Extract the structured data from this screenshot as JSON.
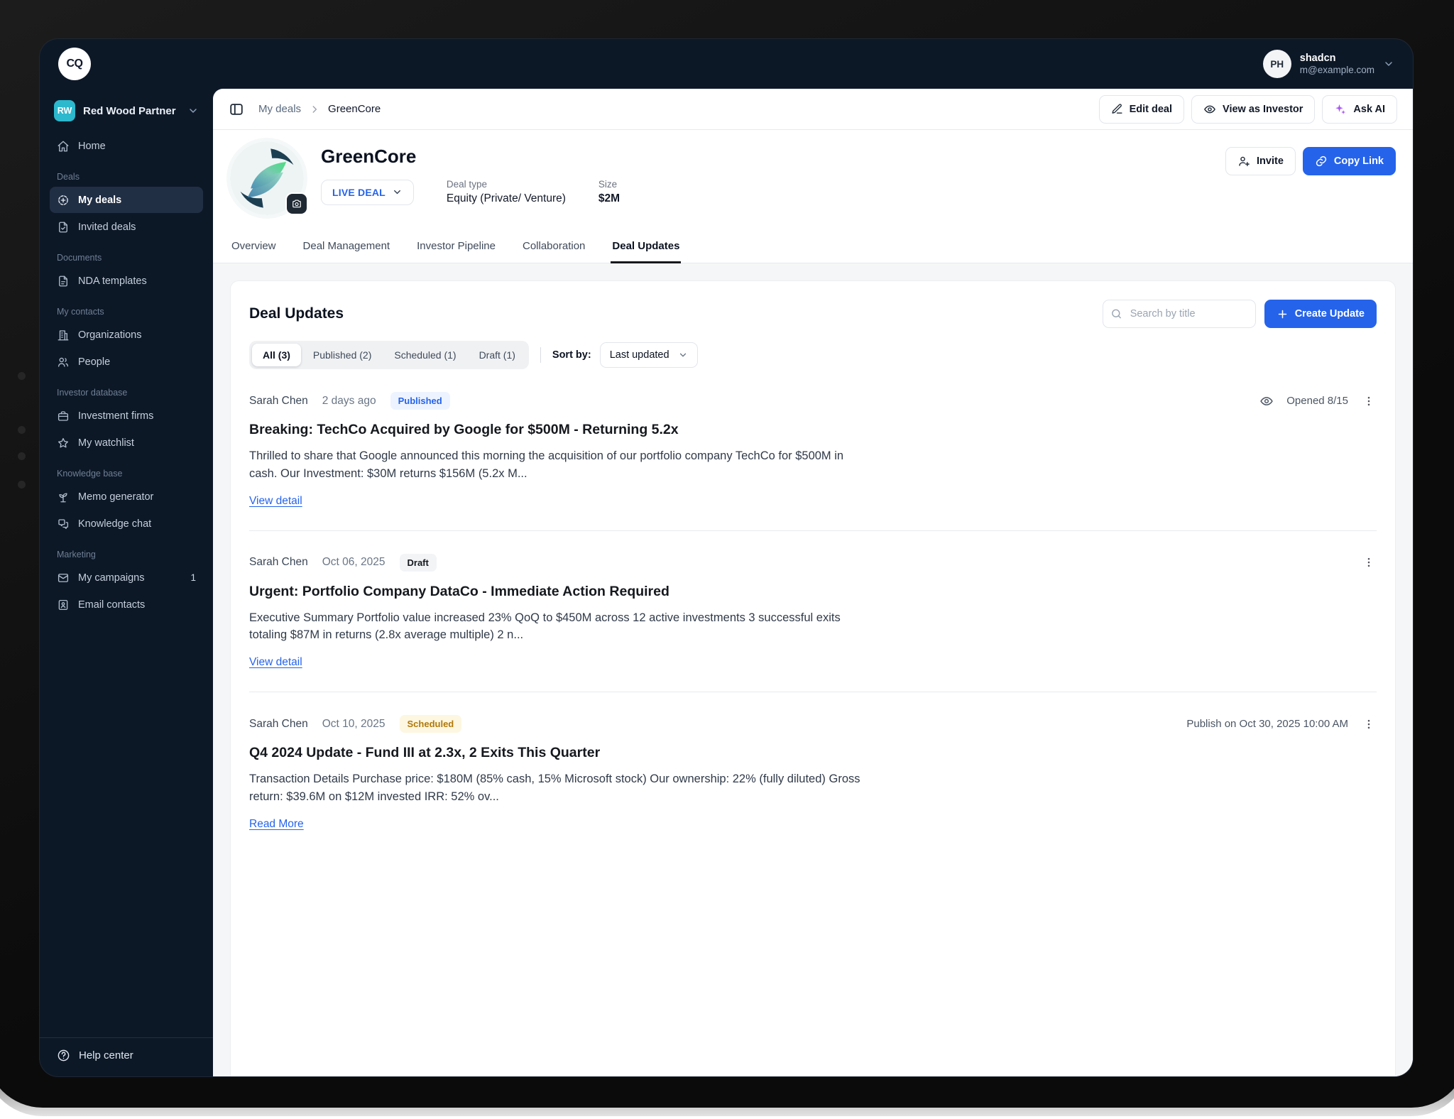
{
  "brand": {
    "logo_text": "CQ"
  },
  "topbar": {
    "user": {
      "initials": "PH",
      "name": "shadcn",
      "email": "m@example.com"
    }
  },
  "sidebar": {
    "workspace": {
      "initials": "RW",
      "name": "Red Wood Partner"
    },
    "home_label": "Home",
    "sections": [
      {
        "label": "Deals",
        "items": [
          {
            "label": "My deals"
          },
          {
            "label": "Invited deals"
          }
        ]
      },
      {
        "label": "Documents",
        "items": [
          {
            "label": "NDA templates"
          }
        ]
      },
      {
        "label": "My contacts",
        "items": [
          {
            "label": "Organizations"
          },
          {
            "label": "People"
          }
        ]
      },
      {
        "label": "Investor database",
        "items": [
          {
            "label": "Investment firms"
          },
          {
            "label": "My watchlist"
          }
        ]
      },
      {
        "label": "Knowledge base",
        "items": [
          {
            "label": "Memo generator"
          },
          {
            "label": "Knowledge chat"
          }
        ]
      },
      {
        "label": "Marketing",
        "items": [
          {
            "label": "My campaigns",
            "badge": "1"
          },
          {
            "label": "Email contacts"
          }
        ]
      }
    ],
    "help_label": "Help center"
  },
  "header": {
    "breadcrumb": {
      "parent": "My deals",
      "current": "GreenCore"
    },
    "actions": {
      "edit": "Edit deal",
      "view_as_investor": "View as Investor",
      "ask_ai": "Ask AI"
    }
  },
  "deal": {
    "name": "GreenCore",
    "status": "LIVE DEAL",
    "deal_type_label": "Deal type",
    "deal_type": "Equity (Private/ Venture)",
    "size_label": "Size",
    "size": "$2M",
    "invite_label": "Invite",
    "copy_link_label": "Copy Link"
  },
  "tabs": [
    "Overview",
    "Deal Management",
    "Investor Pipeline",
    "Collaboration",
    "Deal Updates"
  ],
  "active_tab": "Deal Updates",
  "panel": {
    "title": "Deal Updates",
    "search_placeholder": "Search by title",
    "create_button": "Create Update",
    "filters": [
      "All (3)",
      "Published (2)",
      "Scheduled (1)",
      "Draft (1)"
    ],
    "active_filter": "All (3)",
    "sort_label": "Sort by:",
    "sort_value": "Last updated"
  },
  "updates": [
    {
      "author": "Sarah Chen",
      "date": "2 days ago",
      "status": "Published",
      "opened": "Opened 8/15",
      "title": "Breaking: TechCo Acquired by Google for $500M - Returning 5.2x",
      "excerpt": "Thrilled to share that Google announced this morning the acquisition of our portfolio company TechCo for $500M in cash. Our Investment: $30M returns $156M (5.2x M...",
      "link": "View detail"
    },
    {
      "author": "Sarah Chen",
      "date": "Oct 06, 2025",
      "status": "Draft",
      "title": "Urgent: Portfolio Company DataCo - Immediate Action Required",
      "excerpt": "Executive Summary Portfolio value increased 23% QoQ to $450M across 12 active investments 3 successful exits totaling $87M in returns (2.8x average multiple) 2 n...",
      "link": "View detail"
    },
    {
      "author": "Sarah Chen",
      "date": "Oct 10, 2025",
      "status": "Scheduled",
      "publish_note": "Publish on Oct 30, 2025 10:00 AM",
      "title": "Q4 2024 Update - Fund III at 2.3x, 2 Exits This Quarter",
      "excerpt": "Transaction Details Purchase price: $180M (85% cash, 15% Microsoft stock) Our ownership: 22% (fully diluted) Gross return: $39.6M on $12M invested IRR: 52% ov...",
      "link": "Read More"
    }
  ],
  "colors": {
    "accent_blue": "#2563EB",
    "sidebar_bg": "#0D1827",
    "workspace_badge": "#2CB8CD",
    "published_badge_text": "#2563EB",
    "scheduled_badge_text": "#B07909",
    "ask_ai_sparkle": "#A855F7",
    "live_deal_text": "#2563EB"
  },
  "icon_names": [
    "home-icon",
    "my-deals-icon",
    "invited-deals-icon",
    "nda-templates-icon",
    "organizations-icon",
    "people-icon",
    "investment-firms-icon",
    "watchlist-star-icon",
    "memo-generator-icon",
    "knowledge-chat-icon",
    "campaigns-mail-icon",
    "email-contacts-icon",
    "help-icon",
    "panel-toggle-icon",
    "edit-pencil-icon",
    "eye-icon",
    "sparkles-icon",
    "invite-person-plus-icon",
    "copy-link-icon",
    "camera-icon",
    "search-icon",
    "plus-icon",
    "chevron-down-icon",
    "chevron-right-icon",
    "kebab-menu-icon"
  ]
}
